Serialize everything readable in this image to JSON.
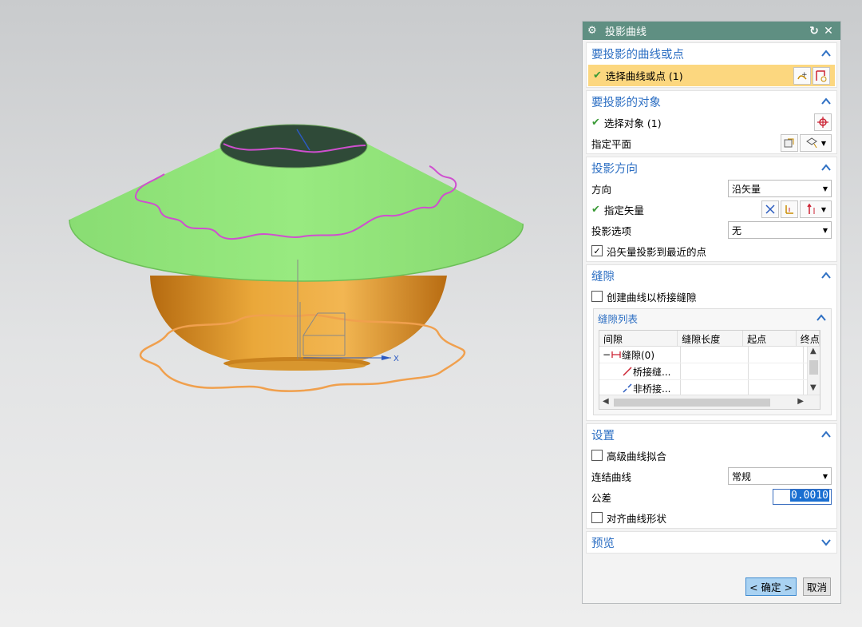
{
  "viewport": {
    "axis_x_label": "X"
  },
  "dialog": {
    "title": "投影曲线",
    "reset_icon": "↻",
    "close_icon": "✕",
    "curves": {
      "title": "要投影的曲线或点",
      "select_label": "选择曲线或点 (1)"
    },
    "objects": {
      "title": "要投影的对象",
      "select_label": "选择对象 (1)",
      "plane_label": "指定平面"
    },
    "direction": {
      "title": "投影方向",
      "dir_label": "方向",
      "dir_value": "沿矢量",
      "vector_label": "指定矢量",
      "option_label": "投影选项",
      "option_value": "无",
      "nearest_label": "沿矢量投影到最近的点",
      "nearest_checked": true
    },
    "gaps": {
      "title": "缝隙",
      "bridge_label": "创建曲线以桥接缝隙",
      "bridge_checked": false,
      "list_title": "缝隙列表",
      "columns": [
        "间隙",
        "缝隙长度",
        "起点",
        "终点"
      ],
      "rows": [
        {
          "expander": "−",
          "label": "缝隙(0)"
        },
        {
          "label": "桥接缝..."
        },
        {
          "label": "非桥接..."
        }
      ]
    },
    "settings": {
      "title": "设置",
      "advanced_label": "高级曲线拟合",
      "advanced_checked": false,
      "join_label": "连结曲线",
      "join_value": "常规",
      "tolerance_label": "公差",
      "tolerance_value": "0.0010",
      "align_label": "对齐曲线形状",
      "align_checked": false
    },
    "preview": {
      "title": "预览"
    },
    "buttons": {
      "ok": "< 确定 >",
      "cancel": "取消"
    }
  },
  "colors": {
    "title_bar": "#5f8f82",
    "section_title": "#2d6fc3",
    "selection_highlight": "#fcd77f",
    "cone": "#93e67c",
    "bowl": "#e8a52c",
    "projected_curve": "#cf4fcf",
    "orange_curve": "#f0a04e"
  }
}
